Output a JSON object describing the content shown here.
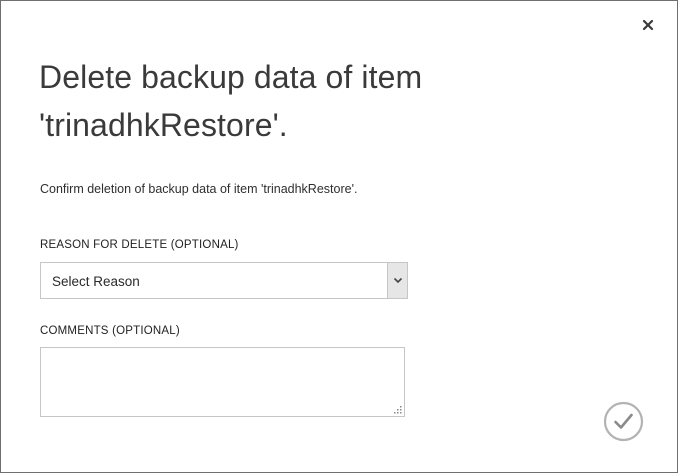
{
  "dialog": {
    "title": "Delete backup data of item 'trinadhkRestore'.",
    "confirm_message": "Confirm deletion of backup data of item 'trinadhkRestore'.",
    "reason_field": {
      "label": "REASON FOR DELETE (OPTIONAL)",
      "selected_value": "Select Reason"
    },
    "comments_field": {
      "label": "COMMENTS (OPTIONAL)",
      "value": ""
    },
    "icons": {
      "close": "close-icon",
      "dropdown": "chevron-down-icon",
      "resize": "resize-grip-icon",
      "confirm": "checkmark-icon"
    },
    "colors": {
      "text": "#222222",
      "title": "#3a3a3a",
      "border": "#c6c6c6",
      "confirm_circle": "#b3b3b3",
      "confirm_check": "#8a8a8a"
    }
  }
}
